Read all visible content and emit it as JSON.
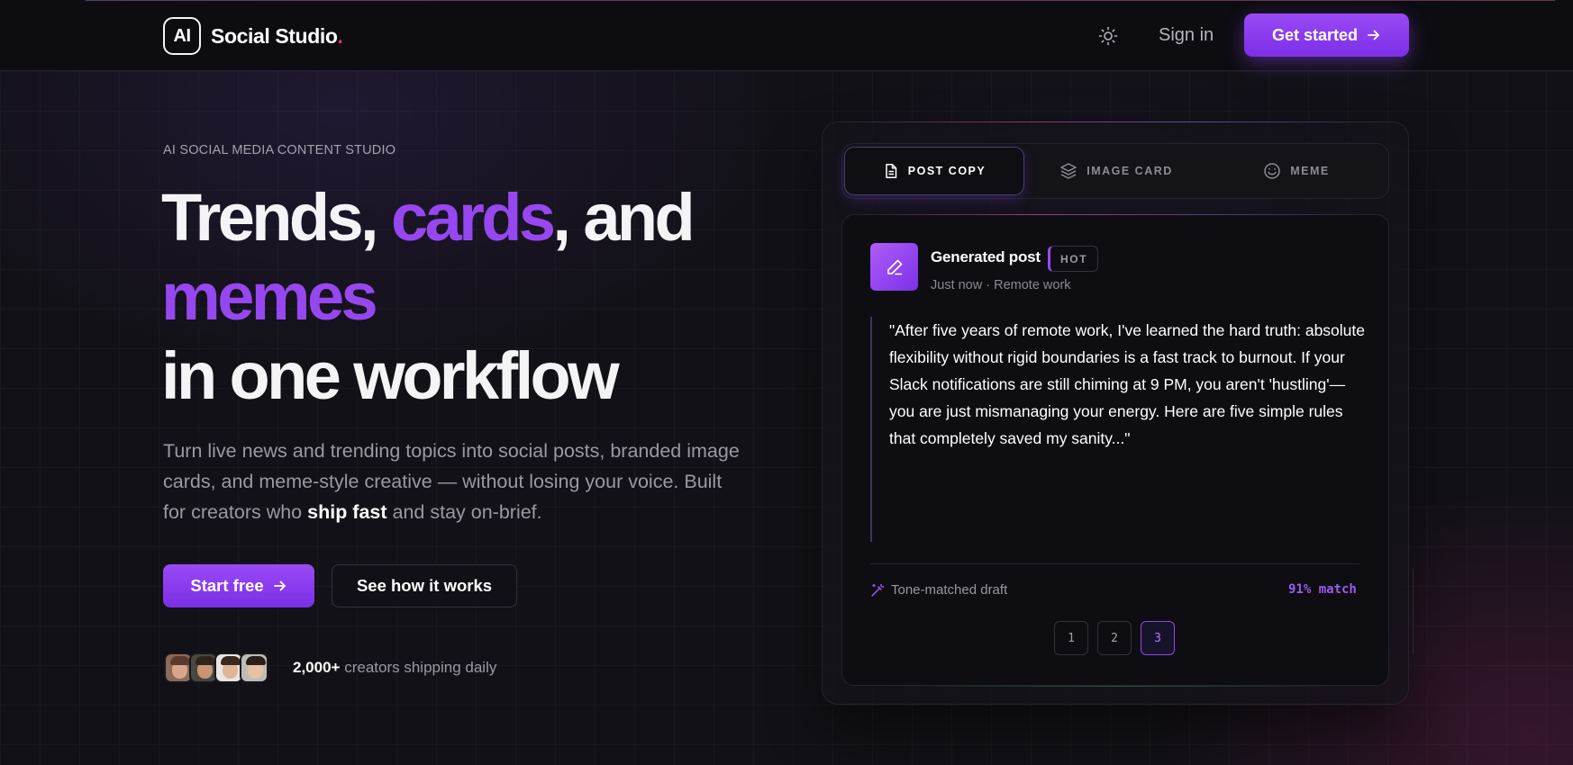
{
  "header": {
    "logo_mark": "AI",
    "logo_text": "Social Studio",
    "logo_dot": ".",
    "theme_icon": "sun-icon",
    "sign_in": "Sign in",
    "cta": "Get started",
    "cta_icon": "arrow-right-icon"
  },
  "hero": {
    "eyebrow": "AI SOCIAL MEDIA CONTENT STUDIO",
    "headline": {
      "part1": "Trends, ",
      "highlight1": "cards",
      "part2": ", and",
      "highlight2": "memes",
      "line3": "in one workflow"
    },
    "subtitle": {
      "before": "Turn live news and trending topics into social posts, branded image cards, and meme-style creative — without losing your voice. Built for creators who ",
      "emphasis": "ship fast",
      "after": " and stay on-brief."
    },
    "primary_button": "Start free",
    "secondary_button": "See how it works",
    "social_count": "2,000+",
    "social_text": " creators shipping daily"
  },
  "panel": {
    "tabs": [
      {
        "label": "POST COPY",
        "icon": "document-icon",
        "active": true
      },
      {
        "label": "IMAGE CARD",
        "icon": "layers-icon",
        "active": false
      },
      {
        "label": "MEME",
        "icon": "smile-icon",
        "active": false
      }
    ],
    "post": {
      "icon": "pencil-icon",
      "title": "Generated post",
      "badge": "HOT",
      "meta": "Just now · Remote work",
      "quote": "\"After five years of remote work, I've learned the hard truth: absolute flexibility without rigid boundaries is a fast track to burnout. If your Slack notifications are still chiming at 9 PM, you aren't 'hustling'—you are just mismanaging your energy. Here are five simple rules that completely saved my sanity...\""
    },
    "footer": {
      "tone_icon": "magic-wand-icon",
      "tone_label": "Tone-matched draft",
      "match": "91% match"
    },
    "pages": [
      "1",
      "2",
      "3"
    ],
    "active_page": "3"
  },
  "colors": {
    "accent": "#9747f0",
    "background": "#121117",
    "logo_dot": "#e5306a"
  }
}
